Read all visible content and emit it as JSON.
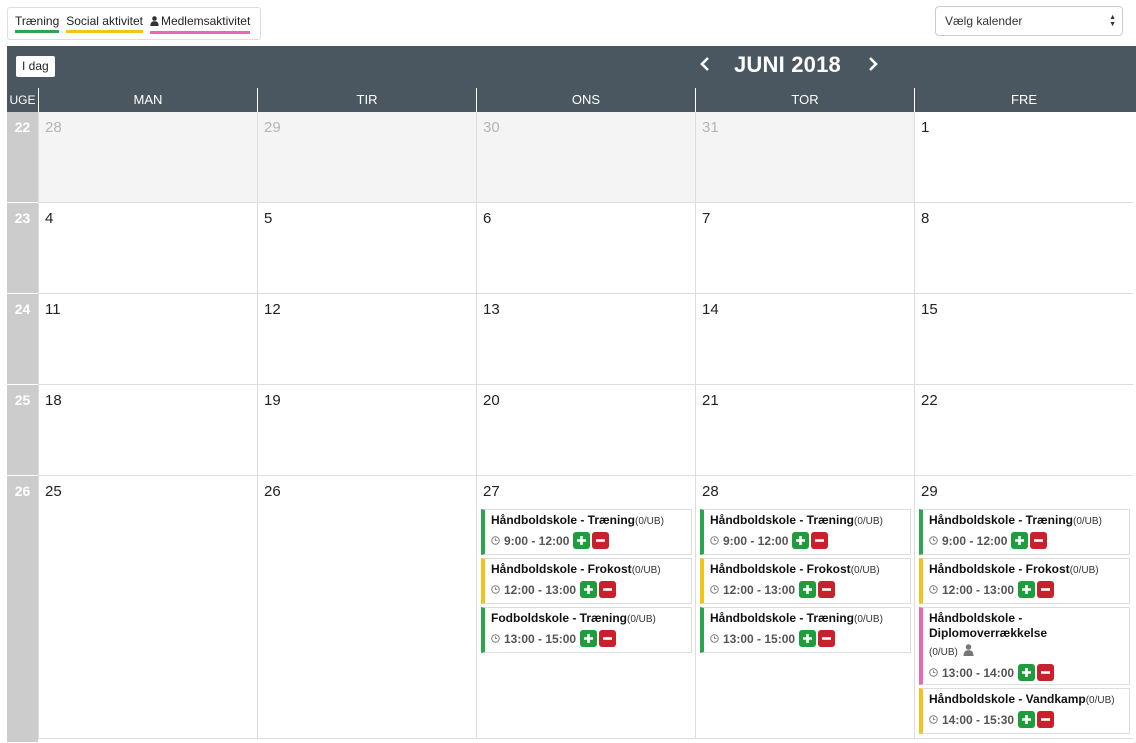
{
  "legend": {
    "training": "Træning",
    "social": "Social aktivitet",
    "member": "Medlemsaktivitet"
  },
  "calendar_select": {
    "value": "Vælg kalender"
  },
  "toolbar": {
    "today_label": "I dag",
    "month_title": "JUNI 2018",
    "prev_icon": "chevron-left",
    "next_icon": "chevron-right"
  },
  "headers": {
    "week": "UGE",
    "days": [
      "MAN",
      "TIR",
      "ONS",
      "TOR",
      "FRE"
    ]
  },
  "weeks": [
    {
      "number": "22",
      "days": [
        "28",
        "29",
        "30",
        "31",
        "1"
      ]
    },
    {
      "number": "23",
      "days": [
        "4",
        "5",
        "6",
        "7",
        "8"
      ]
    },
    {
      "number": "24",
      "days": [
        "11",
        "12",
        "13",
        "14",
        "15"
      ]
    },
    {
      "number": "25",
      "days": [
        "18",
        "19",
        "20",
        "21",
        "22"
      ]
    },
    {
      "number": "26",
      "days": [
        "25",
        "26",
        "27",
        "28",
        "29"
      ]
    }
  ],
  "events": {
    "wed27": [
      {
        "title": "Håndboldskole - Træning",
        "count": "(0/UB)",
        "time": "9:00 - 12:00"
      },
      {
        "title": "Håndboldskole - Frokost",
        "count": "(0/UB)",
        "time": "12:00 - 13:00"
      },
      {
        "title": "Fodboldskole - Træning",
        "count": "(0/UB)",
        "time": "13:00 - 15:00"
      }
    ],
    "thu28": [
      {
        "title": "Håndboldskole - Træning",
        "count": "(0/UB)",
        "time": "9:00 - 12:00"
      },
      {
        "title": "Håndboldskole - Frokost",
        "count": "(0/UB)",
        "time": "12:00 - 13:00"
      },
      {
        "title": "Håndboldskole - Træning",
        "count": "(0/UB)",
        "time": "13:00 - 15:00"
      }
    ],
    "fri29": [
      {
        "title": "Håndboldskole - Træning",
        "count": "(0/UB)",
        "time": "9:00 - 12:00"
      },
      {
        "title": "Håndboldskole - Frokost",
        "count": "(0/UB)",
        "time": "12:00 - 13:00"
      },
      {
        "title_line1": "Håndboldskole -",
        "title_line2": "Diplomoverrækkelse",
        "count": "(0/UB)",
        "time": "13:00 - 14:00"
      },
      {
        "title": "Håndboldskole - Vandkamp",
        "count": "(0/UB)",
        "time": "14:00 - 15:30"
      }
    ]
  },
  "colors": {
    "training": "#2ea44f",
    "social": "#f0c419",
    "member": "#e868b4",
    "header_bg": "#4a5760"
  }
}
